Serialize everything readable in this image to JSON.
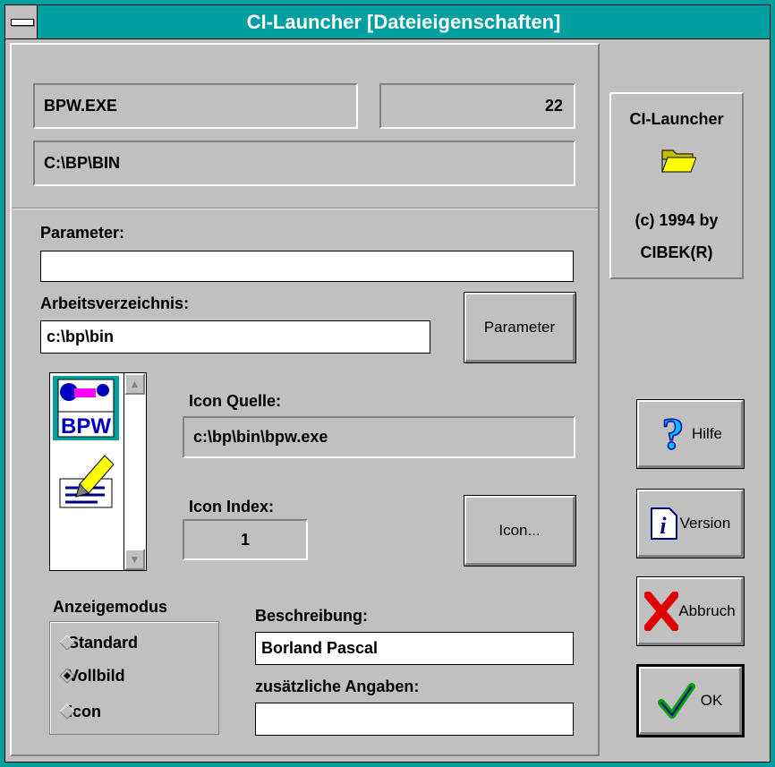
{
  "window": {
    "title": "CI-Launcher [Dateieigenschaften]"
  },
  "file": {
    "name": "BPW.EXE",
    "size": "22",
    "path": "C:\\BP\\BIN"
  },
  "params": {
    "label": "Parameter:",
    "value": ""
  },
  "workdir": {
    "label": "Arbeitsverzeichnis:",
    "value": "c:\\bp\\bin"
  },
  "buttons": {
    "parameter": "Parameter",
    "icon": "Icon...",
    "hilfe": "Hilfe",
    "version": "Version",
    "abbruch": "Abbruch",
    "ok": "OK"
  },
  "icon_source": {
    "label": "Icon Quelle:",
    "value": "c:\\bp\\bin\\bpw.exe"
  },
  "icon_index": {
    "label": "Icon Index:",
    "value": "1"
  },
  "icon_list": [
    {
      "name": "bpw-icon",
      "caption": "BPW",
      "selected": true
    },
    {
      "name": "notepad-edit-icon",
      "selected": false
    }
  ],
  "display_mode": {
    "label": "Anzeigemodus",
    "options": [
      {
        "label": "Standard",
        "selected": false
      },
      {
        "label": "Vollbild",
        "selected": true
      },
      {
        "label": "Icon",
        "selected": false
      }
    ]
  },
  "description": {
    "label": "Beschreibung:",
    "value": "Borland Pascal"
  },
  "extra": {
    "label": "zusätzliche Angaben:",
    "value": ""
  },
  "about": {
    "app": "CI-Launcher",
    "copyright": "(c) 1994 by",
    "company": "CIBEK(R)"
  },
  "colors": {
    "titlebar": "#00a0a0",
    "face": "#c0c0c0"
  }
}
